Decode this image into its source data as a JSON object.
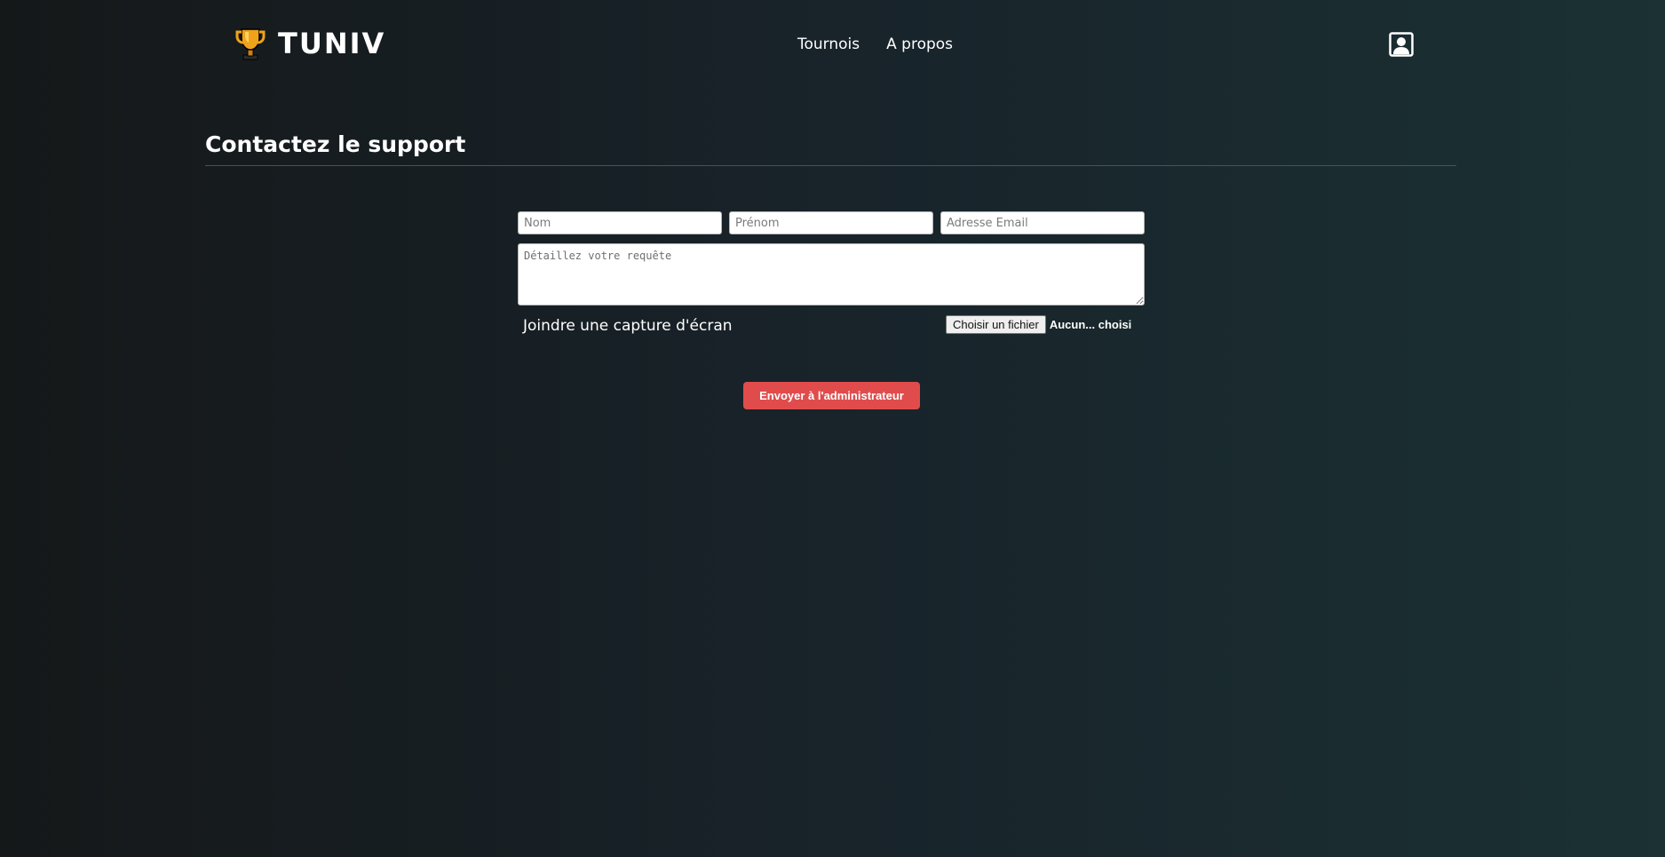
{
  "header": {
    "logo_text": "TUNIV",
    "nav": [
      {
        "label": "Tournois"
      },
      {
        "label": "A propos"
      }
    ],
    "icons": {
      "logo": "trophy-icon",
      "profile": "user-profile-icon"
    }
  },
  "main": {
    "title": "Contactez le support",
    "form": {
      "nom_placeholder": "Nom",
      "prenom_placeholder": "Prénom",
      "email_placeholder": "Adresse Email",
      "details_placeholder": "Détaillez votre requête",
      "attach_label": "Joindre une capture d'écran",
      "file_button_label": "Choisir un fichier",
      "file_status": "Aucun... choisi",
      "submit_label": "Envoyer à l'administrateur"
    }
  },
  "colors": {
    "accent": "#e04c4c",
    "trophy": "#f0a21a"
  }
}
